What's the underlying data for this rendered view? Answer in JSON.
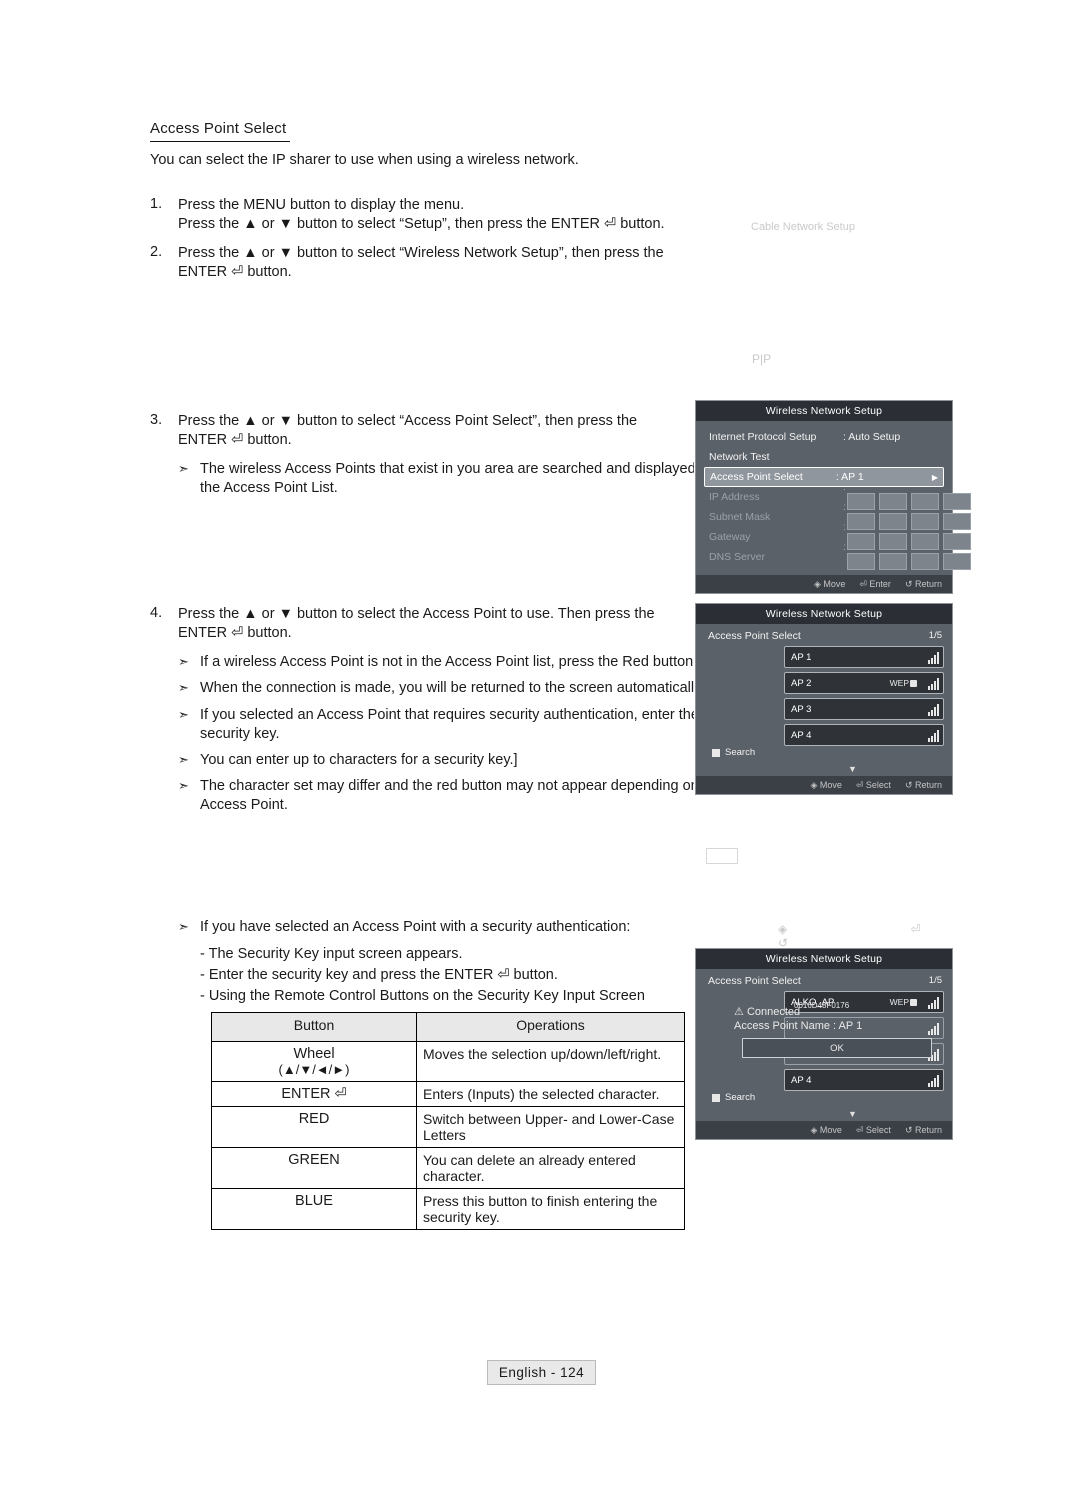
{
  "document": {
    "section_title": "Access Point Select",
    "intro": "You can select the IP sharer to use when using a wireless network.",
    "footer": "English - 124"
  },
  "steps": [
    {
      "num": "1.",
      "lines": [
        "Press the MENU button to display the menu.",
        "Press the ▲ or ▼ button to select “Setup”, then press the ENTER ⏎ button."
      ]
    },
    {
      "num": "2.",
      "lines": [
        "Press the ▲ or ▼ button to select “Wireless Network Setup”, then press the",
        "ENTER ⏎ button."
      ]
    },
    {
      "num": "3.",
      "lines": [
        "Press the ▲ or ▼ button to select “Access Point Select”, then press the",
        "ENTER ⏎ button."
      ],
      "notes": [
        "The wireless Access Points that exist in you area are searched and displayed in the Access Point List."
      ]
    },
    {
      "num": "4.",
      "lines": [
        "Press the ▲ or ▼ button to select the Access Point to use. Then press the",
        "ENTER ⏎ button."
      ],
      "notes": [
        "If a wireless Access Point is not in the Access Point list, press the Red button.",
        "When the connection is made, you will be returned to the screen automatically.",
        "If you selected an Access Point that requires security authentication, enter the security key.",
        "You can enter up to characters for a security key.]",
        "The character set may differ and the red button may not appear depending on the Access Point."
      ]
    }
  ],
  "security_block": {
    "note": "If you have selected an Access Point with a security authentication:",
    "dashes": [
      "- The Security Key input screen appears.",
      "- Enter the security key and press the ENTER ⏎ button.",
      "- Using the Remote Control Buttons on the Security Key Input Screen"
    ]
  },
  "key_table": {
    "headers": [
      "Button",
      "Operations"
    ],
    "rows": [
      {
        "button": "Wheel",
        "button_sub": "(▲/▼/◄/►)",
        "operation": "Moves the selection up/down/left/right."
      },
      {
        "button": "ENTER ⏎",
        "button_sub": "",
        "operation": "Enters (Inputs) the selected character."
      },
      {
        "button": "RED",
        "button_sub": "",
        "operation": "Switch between Upper- and Lower-Case Letters"
      },
      {
        "button": "GREEN",
        "button_sub": "",
        "operation": "You can delete an already entered character."
      },
      {
        "button": "BLUE",
        "button_sub": "",
        "operation": "Press this button to finish entering the security key."
      }
    ]
  },
  "osd_panels": {
    "panel1": {
      "title": "Wireless Network Setup",
      "rows": [
        {
          "label": "Internet Protocol Setup",
          "value": ": Auto Setup",
          "selected": false,
          "dim": false
        },
        {
          "label": "Network Test",
          "value": "",
          "selected": false,
          "dim": false
        },
        {
          "label": "Access Point Select",
          "value": ": AP 1",
          "selected": true,
          "dim": false
        },
        {
          "label": "IP Address",
          "value": ":",
          "selected": false,
          "dim": true
        },
        {
          "label": "Subnet Mask",
          "value": ":",
          "selected": false,
          "dim": true
        },
        {
          "label": "Gateway",
          "value": ":",
          "selected": false,
          "dim": true
        },
        {
          "label": "DNS Server",
          "value": ":",
          "selected": false,
          "dim": true
        }
      ],
      "footer": [
        "Move",
        "Enter",
        "Return"
      ]
    },
    "panel2": {
      "title": "Wireless Network Setup",
      "list_label": "Access Point Select",
      "page": "1/5",
      "items": [
        {
          "name": "AP 1",
          "security": "",
          "locked": false
        },
        {
          "name": "AP 2",
          "security": "WEP",
          "locked": true
        },
        {
          "name": "AP 3",
          "security": "",
          "locked": false
        },
        {
          "name": "AP 4",
          "security": "",
          "locked": false
        }
      ],
      "search_label": "Search",
      "footer": [
        "Move",
        "Select",
        "Return"
      ]
    },
    "panel3": {
      "title": "Wireless Network Setup",
      "list_label": "Access Point Select",
      "page": "1/5",
      "dialog": {
        "warn_line": "Connected",
        "ap_name_line": "Access Point Name : AP 1",
        "mac_line": "0016D48F0176",
        "ok_label": "OK"
      },
      "items": [
        {
          "name": "ALKO_AP",
          "security": "WEP",
          "locked": true
        },
        {
          "name": "AP 4",
          "security": "",
          "locked": false
        }
      ],
      "search_label": "Search",
      "footer": [
        "Move",
        "Select",
        "Return"
      ]
    }
  },
  "ghosts": {
    "cable_network_setup": "Cable Network Setup",
    "pip": "P|P"
  }
}
